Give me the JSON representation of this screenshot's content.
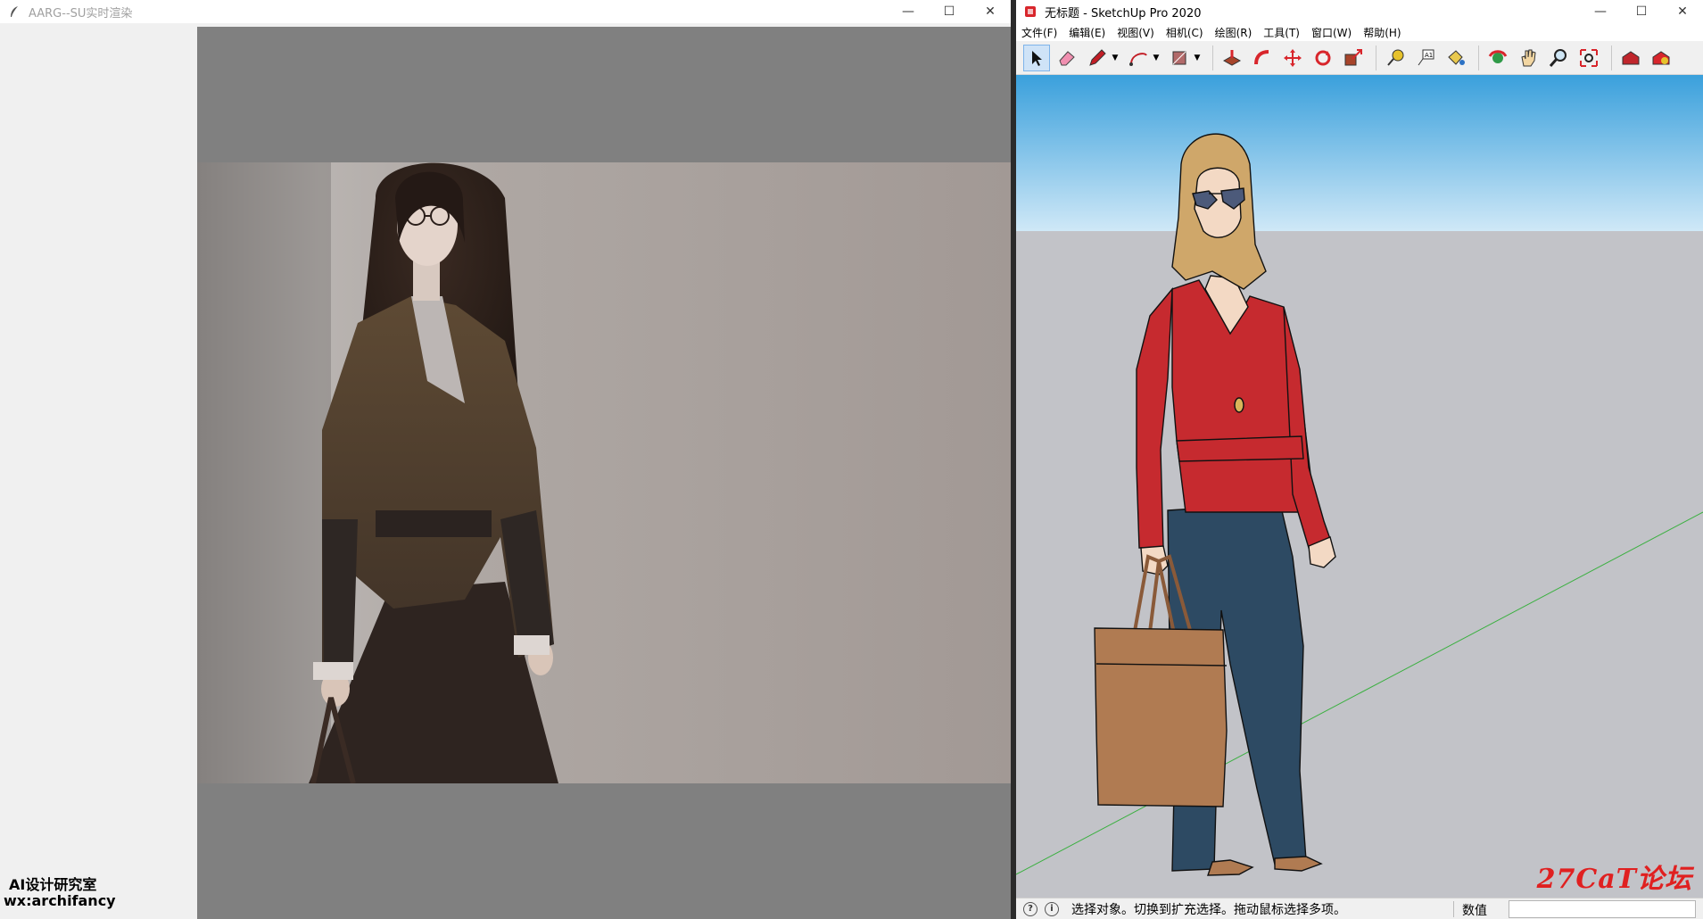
{
  "left_window": {
    "title": "AARG--SU实时渲染",
    "controls": {
      "minimize": "—",
      "maximize": "☐",
      "close": "✕"
    },
    "watermark_line1": "AI设计研究室",
    "watermark_line2": "wx:archifancy"
  },
  "right_window": {
    "title": "无标题 - SketchUp Pro 2020",
    "controls": {
      "minimize": "—",
      "maximize": "☐",
      "close": "✕"
    },
    "menu": [
      "文件(F)",
      "编辑(E)",
      "视图(V)",
      "相机(C)",
      "绘图(R)",
      "工具(T)",
      "窗口(W)",
      "帮助(H)"
    ],
    "tools": [
      "select-icon",
      "eraser-icon",
      "pencil-icon",
      "arc-icon",
      "rectangle-icon",
      "push-pull-icon",
      "follow-me-icon",
      "move-icon",
      "rotate-icon",
      "scale-icon",
      "tape-measure-icon",
      "text-icon",
      "paint-bucket-icon",
      "orbit-icon",
      "pan-icon",
      "zoom-icon",
      "zoom-extents-icon",
      "warehouse-icon",
      "extension-icon"
    ],
    "status_text": "选择对象。切换到扩充选择。拖动鼠标选择多项。",
    "measurements_label": "数值",
    "forum_logo": "27CaT论坛"
  },
  "colors": {
    "sky_top": "#3aa0dc",
    "sky_bottom": "#cfe8f7",
    "ground": "#c2c3c8",
    "shirt": "#c62a2f",
    "pants": "#2d4a63",
    "bag": "#b07b52",
    "hair": "#cfa76a"
  }
}
